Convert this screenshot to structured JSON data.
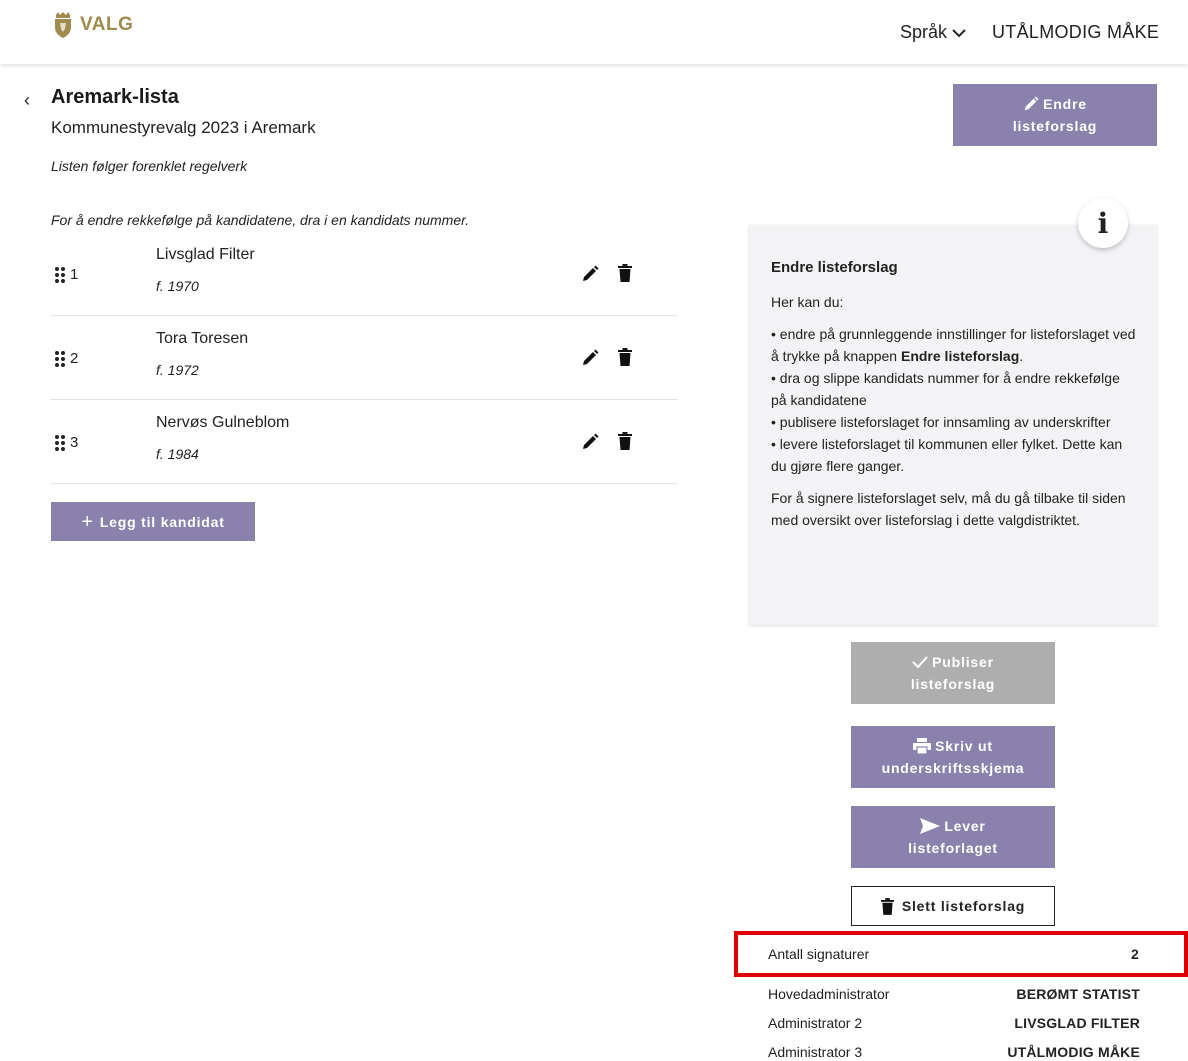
{
  "header": {
    "logo_text": "VALG",
    "language_label": "Språk",
    "user_name": "UTÅLMODIG MÅKE"
  },
  "list": {
    "title": "Aremark-lista",
    "subtitle": "Kommunestyrevalg 2023 i Aremark",
    "rules_note": "Listen følger forenklet regelverk",
    "reorder_hint": "For å endre rekkefølge på kandidatene, dra i en kandidats nummer."
  },
  "candidates": [
    {
      "number": "1",
      "name": "Livsglad Filter",
      "birth": "f. 1970"
    },
    {
      "number": "2",
      "name": "Tora Toresen",
      "birth": "f. 1972"
    },
    {
      "number": "3",
      "name": "Nervøs Gulneblom",
      "birth": "f. 1984"
    }
  ],
  "buttons": {
    "add_candidate": "Legg til kandidat",
    "edit_list_line1": "Endre",
    "edit_list_line2": "listeforslag",
    "publish_line1": "Publiser",
    "publish_line2": "listeforslag",
    "print_line1": "Skriv ut",
    "print_line2": "underskriftsskjema",
    "deliver_line1": "Lever",
    "deliver_line2": "listeforlaget",
    "delete": "Slett listeforslag"
  },
  "info": {
    "badge": "i",
    "title": "Endre listeforslag",
    "intro": "Her kan du:",
    "b1_pre": "• endre på grunnleggende innstillinger for listeforslaget ved å trykke på knappen ",
    "b1_bold": "Endre listeforslag",
    "b1_post": ".",
    "b2": "• dra og slippe kandidats nummer for å endre rekkefølge på kandidatene",
    "b3": "• publisere listeforslaget for innsamling av underskrifter",
    "b4": "• levere listeforslaget til kommunen eller fylket. Dette kan du gjøre flere ganger.",
    "outro": "For å signere listeforslaget selv, må du gå tilbake til siden med oversikt over listeforslag i dette valgdistriktet."
  },
  "signatures": {
    "label": "Antall signaturer",
    "value": "2"
  },
  "admins": [
    {
      "label": "Hovedadministrator",
      "value": "BERØMT STATIST"
    },
    {
      "label": "Administrator 2",
      "value": "LIVSGLAD FILTER"
    },
    {
      "label": "Administrator 3",
      "value": "UTÅLMODIG MÅKE"
    }
  ],
  "colors": {
    "primary_button": "#8a81ad",
    "disabled_button": "#aeaeae",
    "logo_gold": "#a08a4e",
    "highlight_border": "#e00000"
  }
}
